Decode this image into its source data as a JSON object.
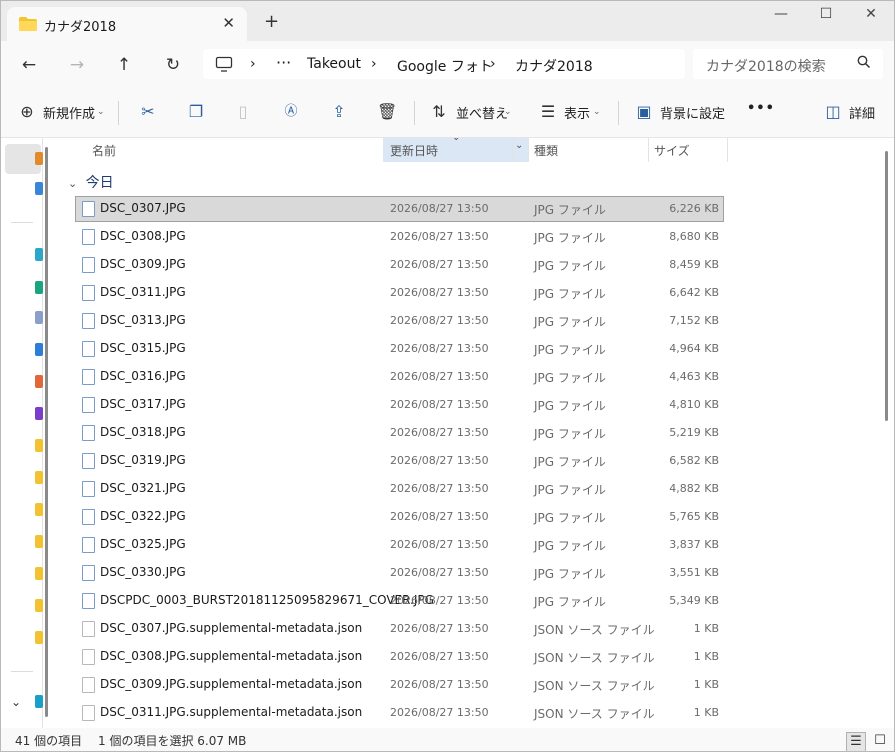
{
  "window": {
    "tab_title": "カナダ2018",
    "tab_close": "✕",
    "new_tab": "+",
    "minimize": "—",
    "maximize": "☐",
    "close": "✕"
  },
  "nav": {
    "back": "←",
    "forward": "→",
    "up": "↑",
    "refresh": "↻",
    "computer_icon": "monitor-icon",
    "more": "···",
    "breadcrumb": [
      "Takeout",
      "Google フォト",
      "カナダ2018"
    ],
    "separator": "›",
    "search_placeholder": "カナダ2018の検索"
  },
  "toolbar": {
    "new_label": "新規作成",
    "sort_label": "並べ替え",
    "view_label": "表示",
    "wallpaper_label": "背景に設定",
    "more": "•••",
    "details_label": "詳細"
  },
  "columns": {
    "name": "名前",
    "modified": "更新日時",
    "type": "種類",
    "size": "サイズ"
  },
  "group_label": "今日",
  "files": [
    {
      "name": "DSC_0307.JPG",
      "date": "2026/08/27 13:50",
      "type": "JPG ファイル",
      "size": "6,226 KB",
      "kind": "jpg",
      "selected": true
    },
    {
      "name": "DSC_0308.JPG",
      "date": "2026/08/27 13:50",
      "type": "JPG ファイル",
      "size": "8,680 KB",
      "kind": "jpg"
    },
    {
      "name": "DSC_0309.JPG",
      "date": "2026/08/27 13:50",
      "type": "JPG ファイル",
      "size": "8,459 KB",
      "kind": "jpg"
    },
    {
      "name": "DSC_0311.JPG",
      "date": "2026/08/27 13:50",
      "type": "JPG ファイル",
      "size": "6,642 KB",
      "kind": "jpg"
    },
    {
      "name": "DSC_0313.JPG",
      "date": "2026/08/27 13:50",
      "type": "JPG ファイル",
      "size": "7,152 KB",
      "kind": "jpg"
    },
    {
      "name": "DSC_0315.JPG",
      "date": "2026/08/27 13:50",
      "type": "JPG ファイル",
      "size": "4,964 KB",
      "kind": "jpg"
    },
    {
      "name": "DSC_0316.JPG",
      "date": "2026/08/27 13:50",
      "type": "JPG ファイル",
      "size": "4,463 KB",
      "kind": "jpg"
    },
    {
      "name": "DSC_0317.JPG",
      "date": "2026/08/27 13:50",
      "type": "JPG ファイル",
      "size": "4,810 KB",
      "kind": "jpg"
    },
    {
      "name": "DSC_0318.JPG",
      "date": "2026/08/27 13:50",
      "type": "JPG ファイル",
      "size": "5,219 KB",
      "kind": "jpg"
    },
    {
      "name": "DSC_0319.JPG",
      "date": "2026/08/27 13:50",
      "type": "JPG ファイル",
      "size": "6,582 KB",
      "kind": "jpg"
    },
    {
      "name": "DSC_0321.JPG",
      "date": "2026/08/27 13:50",
      "type": "JPG ファイル",
      "size": "4,882 KB",
      "kind": "jpg"
    },
    {
      "name": "DSC_0322.JPG",
      "date": "2026/08/27 13:50",
      "type": "JPG ファイル",
      "size": "5,765 KB",
      "kind": "jpg"
    },
    {
      "name": "DSC_0325.JPG",
      "date": "2026/08/27 13:50",
      "type": "JPG ファイル",
      "size": "3,837 KB",
      "kind": "jpg"
    },
    {
      "name": "DSC_0330.JPG",
      "date": "2026/08/27 13:50",
      "type": "JPG ファイル",
      "size": "3,551 KB",
      "kind": "jpg"
    },
    {
      "name": "DSCPDC_0003_BURST20181125095829671_COVER.JPG",
      "date": "2026/08/27 13:50",
      "type": "JPG ファイル",
      "size": "5,349 KB",
      "kind": "jpg"
    },
    {
      "name": "DSC_0307.JPG.supplemental-metadata.json",
      "date": "2026/08/27 13:50",
      "type": "JSON ソース ファイル",
      "size": "1 KB",
      "kind": "json"
    },
    {
      "name": "DSC_0308.JPG.supplemental-metadata.json",
      "date": "2026/08/27 13:50",
      "type": "JSON ソース ファイル",
      "size": "1 KB",
      "kind": "json"
    },
    {
      "name": "DSC_0309.JPG.supplemental-metadata.json",
      "date": "2026/08/27 13:50",
      "type": "JSON ソース ファイル",
      "size": "1 KB",
      "kind": "json"
    },
    {
      "name": "DSC_0311.JPG.supplemental-metadata.json",
      "date": "2026/08/27 13:50",
      "type": "JSON ソース ファイル",
      "size": "1 KB",
      "kind": "json"
    }
  ],
  "status": {
    "item_count": "41 個の項目",
    "selection": "1 個の項目を選択  6.07 MB"
  },
  "colors": {
    "accent": "#0067c0",
    "sort_header_bg": "#dbe7f5",
    "selection_bg": "#d9d9d9"
  }
}
